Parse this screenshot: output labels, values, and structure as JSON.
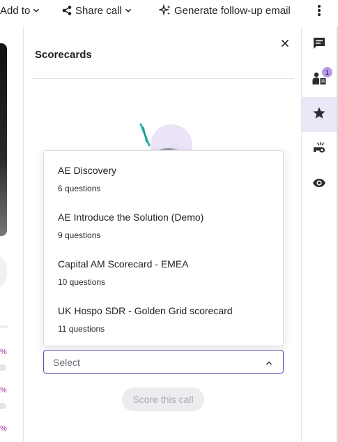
{
  "toolbar": {
    "add_label": "Add to",
    "share_label": "Share call",
    "generate_label": "Generate follow-up email"
  },
  "left": {
    "percent_symbols": [
      "%",
      "%",
      "%"
    ]
  },
  "panel": {
    "title": "Scorecards",
    "dropdown": {
      "options": [
        {
          "name": "AE Discovery",
          "count": "6 questions"
        },
        {
          "name": "AE Introduce the Solution (Demo)",
          "count": "9 questions"
        },
        {
          "name": "Capital AM Scorecard - EMEA",
          "count": "10 questions"
        },
        {
          "name": "UK Hospo SDR - Golden Grid scorecard",
          "count": "11 questions"
        }
      ]
    },
    "select": {
      "value": "Select"
    },
    "score_button": "Score this call"
  },
  "rail": {
    "items": [
      {
        "icon": "comment-icon"
      },
      {
        "icon": "participants-icon",
        "badge": "1"
      },
      {
        "icon": "star-icon",
        "active": true
      },
      {
        "icon": "whistle-icon"
      },
      {
        "icon": "eye-icon"
      }
    ]
  },
  "colors": {
    "accent": "#6b46b8",
    "active_bg": "#ece7f6",
    "badge": "#b79be6",
    "percent_text": "#a63aa8"
  }
}
